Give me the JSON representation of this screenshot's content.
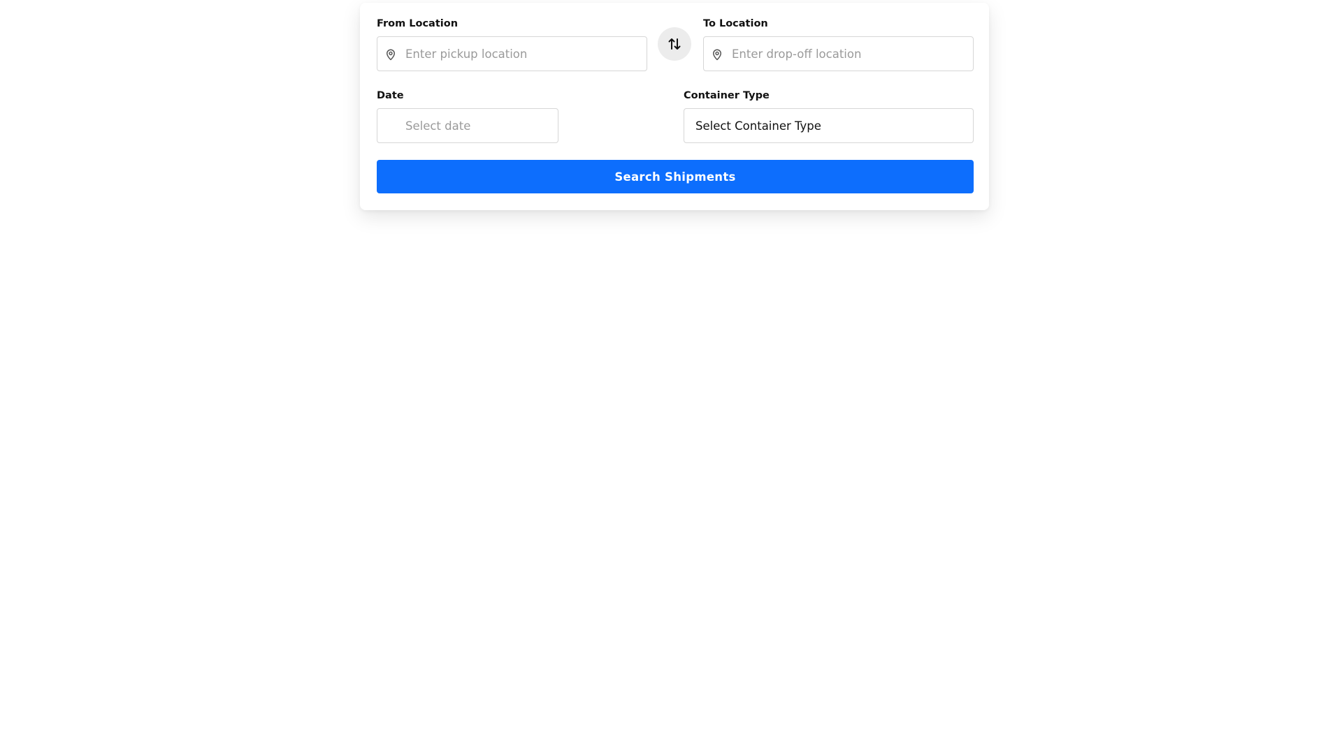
{
  "form": {
    "from": {
      "label": "From Location",
      "placeholder": "Enter pickup location",
      "value": "",
      "icon": "map-pin-icon"
    },
    "to": {
      "label": "To Location",
      "placeholder": "Enter drop-off location",
      "value": "",
      "icon": "map-pin-icon"
    },
    "swap": {
      "icon": "swap-vertical-arrows-icon"
    },
    "date": {
      "label": "Date",
      "placeholder": "Select date",
      "value": ""
    },
    "container": {
      "label": "Container Type",
      "selected": "Select Container Type"
    },
    "submit_label": "Search Shipments"
  },
  "colors": {
    "primary": "#0d6efd",
    "border": "#d6d6d6",
    "swap_bg": "#ececec",
    "placeholder": "#9a9a9a"
  }
}
